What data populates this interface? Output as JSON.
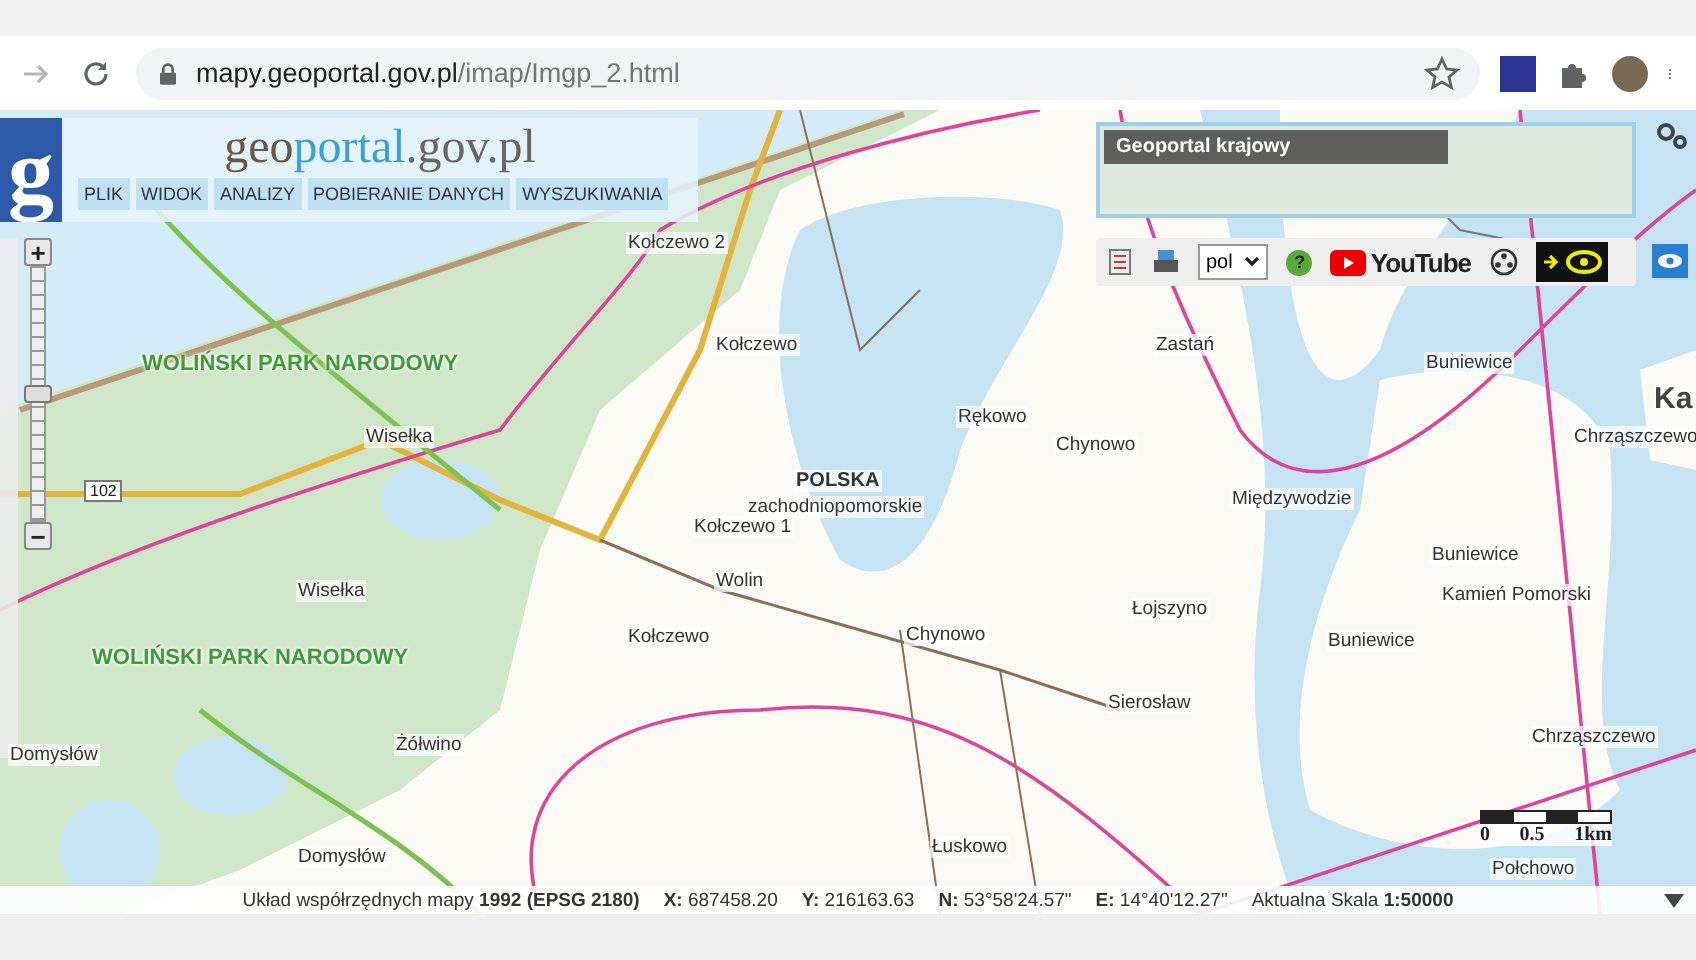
{
  "browser": {
    "url_host": "mapy.geoportal.gov.pl",
    "url_path": "/imap/Imgp_2.html",
    "forward_disabled": true,
    "bookmarked": false
  },
  "header": {
    "logo": "g",
    "title_parts": [
      "geo",
      "portal",
      ".gov.pl"
    ],
    "menu": [
      "PLIK",
      "WIDOK",
      "ANALIZY",
      "POBIERANIE DANYCH",
      "WYSZUKIWANIA"
    ]
  },
  "overview": {
    "title": "Geoportal krajowy"
  },
  "toolbar": {
    "language": "pol",
    "help": "?",
    "video_label": "YouTube"
  },
  "zoom": {
    "plus": "+",
    "minus": "−",
    "level": 0.5
  },
  "map": {
    "labels": [
      {
        "text": "Kołczewo 2",
        "kind": "town"
      },
      {
        "text": "Kołczewo",
        "kind": "town"
      },
      {
        "text": "WOLIŃSKI PARK NARODOWY",
        "kind": "park"
      },
      {
        "text": "Wisełka",
        "kind": "town"
      },
      {
        "text": "102",
        "kind": "road"
      },
      {
        "text": "POLSKA",
        "kind": "region"
      },
      {
        "text": "zachodniopomorskie",
        "kind": "town"
      },
      {
        "text": "Kołczewo 1",
        "kind": "town"
      },
      {
        "text": "Wolin",
        "kind": "town"
      },
      {
        "text": "Rękowo",
        "kind": "town"
      },
      {
        "text": "Chynowo",
        "kind": "town"
      },
      {
        "text": "Zastań",
        "kind": "town"
      },
      {
        "text": "Międzywodzie",
        "kind": "town"
      },
      {
        "text": "Buniewice",
        "kind": "town"
      },
      {
        "text": "Buniewice",
        "kind": "town"
      },
      {
        "text": "Kamień Pomorski",
        "kind": "town"
      },
      {
        "text": "Buniewice",
        "kind": "town"
      },
      {
        "text": "Chrząszczewo",
        "kind": "town"
      },
      {
        "text": "Łojszyno",
        "kind": "town"
      },
      {
        "text": "Sierosław",
        "kind": "town"
      },
      {
        "text": "Chynowo",
        "kind": "town"
      },
      {
        "text": "Łuskowo",
        "kind": "town"
      },
      {
        "text": "Wisełka",
        "kind": "town"
      },
      {
        "text": "WOLIŃSKI PARK NARODOWY",
        "kind": "park"
      },
      {
        "text": "Kołczewo",
        "kind": "town"
      },
      {
        "text": "Żółwino",
        "kind": "town"
      },
      {
        "text": "Domysłów",
        "kind": "town"
      },
      {
        "text": "Domysłów",
        "kind": "town"
      },
      {
        "text": "Połchowo",
        "kind": "town"
      },
      {
        "text": "Ka",
        "kind": "big"
      },
      {
        "text": "Chrząszczewo",
        "kind": "town"
      }
    ],
    "scale": [
      "0",
      "0.5",
      "1km"
    ]
  },
  "status_bar": [
    "Układ współrzędnych mapy **1992 (EPSG 2180)**",
    "**X:** 687458.20",
    "**Y:** 216163.63",
    "**N:** 53°58'24.57\"",
    "**E:** 14°40'12.27\"",
    "Aktualna Skala **1:50000**"
  ]
}
